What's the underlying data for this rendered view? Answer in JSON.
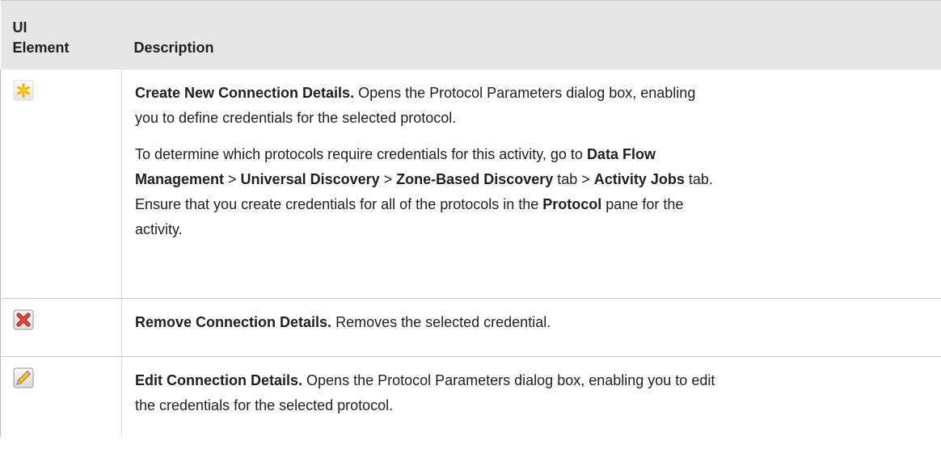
{
  "table": {
    "header": {
      "col1_line1": "UI",
      "col1_line2": "Element",
      "col2": "Description"
    },
    "rows": [
      {
        "icon": "asterisk-new-icon",
        "title": "Create New Connection Details.",
        "desc1a": " Opens the Protocol Parameters dialog box, enabling",
        "desc1b": "you to define credentials for the selected protocol.",
        "p2": {
          "l1_text": "To determine which protocols require credentials for this activity, go to ",
          "l1_bold": "Data Flow",
          "l2_b1": "Management",
          "sep1": " > ",
          "l2_b2": "Universal Discovery",
          "sep2": " > ",
          "l2_b3": "Zone-Based Discovery",
          "l2_t1": " tab > ",
          "l2_b4": "Activity Jobs",
          "l2_t2": " tab.",
          "l3_text": "Ensure that you create credentials for all of the protocols in the ",
          "l3_bold": "Protocol",
          "l3_tail": " pane for the",
          "l4_text": "activity."
        }
      },
      {
        "icon": "red-x-remove-icon",
        "title": "Remove Connection Details.",
        "desc": " Removes the selected credential."
      },
      {
        "icon": "pencil-edit-icon",
        "title": "Edit Connection Details.",
        "desc1": " Opens the Protocol Parameters dialog box, enabling you to edit",
        "desc2": "the credentials for the selected protocol."
      }
    ]
  }
}
